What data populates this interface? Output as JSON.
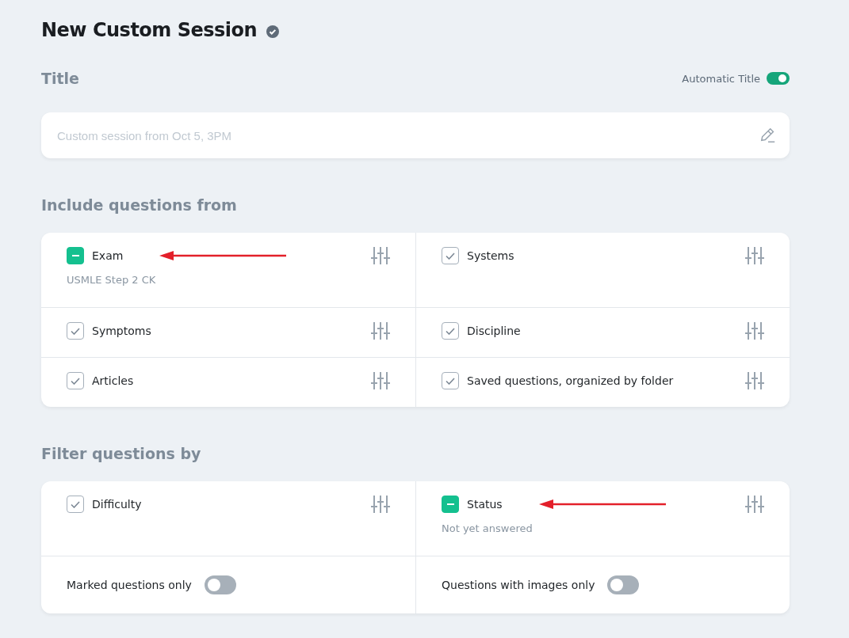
{
  "page": {
    "title": "New Custom Session"
  },
  "title_section": {
    "heading": "Title",
    "auto_toggle": {
      "label": "Automatic Title",
      "on": true
    },
    "field": {
      "placeholder": "Custom session from Oct 5, 3PM"
    }
  },
  "include_section": {
    "heading": "Include questions from",
    "items": [
      {
        "kind": "option",
        "label": "Exam",
        "checked": true,
        "partial": true,
        "detail": "USMLE Step 2 CK",
        "arrow": true
      },
      {
        "kind": "option",
        "label": "Systems",
        "checked": true,
        "partial": false,
        "arrow": false
      },
      {
        "kind": "option",
        "label": "Symptoms",
        "checked": true,
        "partial": false,
        "arrow": false
      },
      {
        "kind": "option",
        "label": "Discipline",
        "checked": true,
        "partial": false,
        "arrow": false
      },
      {
        "kind": "option",
        "label": "Articles",
        "checked": true,
        "partial": false,
        "arrow": false
      },
      {
        "kind": "option",
        "label": "Saved questions, organized by folder",
        "checked": true,
        "partial": false,
        "arrow": false
      }
    ]
  },
  "filter_section": {
    "heading": "Filter questions by",
    "items": [
      {
        "kind": "option",
        "label": "Difficulty",
        "checked": true,
        "partial": false,
        "arrow": false
      },
      {
        "kind": "option",
        "label": "Status",
        "checked": true,
        "partial": true,
        "detail": "Not yet answered",
        "arrow": true
      },
      {
        "kind": "toggle",
        "label": "Marked questions only",
        "on": false
      },
      {
        "kind": "toggle",
        "label": "Questions with images only",
        "on": false
      }
    ]
  }
}
